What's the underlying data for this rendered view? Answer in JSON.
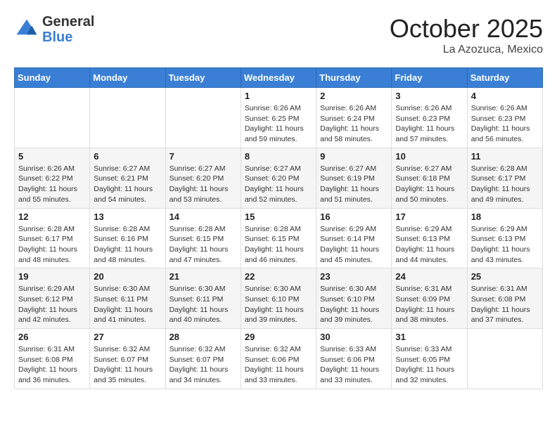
{
  "header": {
    "logo_general": "General",
    "logo_blue": "Blue",
    "month_title": "October 2025",
    "location": "La Azozuca, Mexico"
  },
  "calendar": {
    "days_of_week": [
      "Sunday",
      "Monday",
      "Tuesday",
      "Wednesday",
      "Thursday",
      "Friday",
      "Saturday"
    ],
    "weeks": [
      [
        {
          "day": "",
          "info": ""
        },
        {
          "day": "",
          "info": ""
        },
        {
          "day": "",
          "info": ""
        },
        {
          "day": "1",
          "info": "Sunrise: 6:26 AM\nSunset: 6:25 PM\nDaylight: 11 hours and 59 minutes."
        },
        {
          "day": "2",
          "info": "Sunrise: 6:26 AM\nSunset: 6:24 PM\nDaylight: 11 hours and 58 minutes."
        },
        {
          "day": "3",
          "info": "Sunrise: 6:26 AM\nSunset: 6:23 PM\nDaylight: 11 hours and 57 minutes."
        },
        {
          "day": "4",
          "info": "Sunrise: 6:26 AM\nSunset: 6:23 PM\nDaylight: 11 hours and 56 minutes."
        }
      ],
      [
        {
          "day": "5",
          "info": "Sunrise: 6:26 AM\nSunset: 6:22 PM\nDaylight: 11 hours and 55 minutes."
        },
        {
          "day": "6",
          "info": "Sunrise: 6:27 AM\nSunset: 6:21 PM\nDaylight: 11 hours and 54 minutes."
        },
        {
          "day": "7",
          "info": "Sunrise: 6:27 AM\nSunset: 6:20 PM\nDaylight: 11 hours and 53 minutes."
        },
        {
          "day": "8",
          "info": "Sunrise: 6:27 AM\nSunset: 6:20 PM\nDaylight: 11 hours and 52 minutes."
        },
        {
          "day": "9",
          "info": "Sunrise: 6:27 AM\nSunset: 6:19 PM\nDaylight: 11 hours and 51 minutes."
        },
        {
          "day": "10",
          "info": "Sunrise: 6:27 AM\nSunset: 6:18 PM\nDaylight: 11 hours and 50 minutes."
        },
        {
          "day": "11",
          "info": "Sunrise: 6:28 AM\nSunset: 6:17 PM\nDaylight: 11 hours and 49 minutes."
        }
      ],
      [
        {
          "day": "12",
          "info": "Sunrise: 6:28 AM\nSunset: 6:17 PM\nDaylight: 11 hours and 48 minutes."
        },
        {
          "day": "13",
          "info": "Sunrise: 6:28 AM\nSunset: 6:16 PM\nDaylight: 11 hours and 48 minutes."
        },
        {
          "day": "14",
          "info": "Sunrise: 6:28 AM\nSunset: 6:15 PM\nDaylight: 11 hours and 47 minutes."
        },
        {
          "day": "15",
          "info": "Sunrise: 6:28 AM\nSunset: 6:15 PM\nDaylight: 11 hours and 46 minutes."
        },
        {
          "day": "16",
          "info": "Sunrise: 6:29 AM\nSunset: 6:14 PM\nDaylight: 11 hours and 45 minutes."
        },
        {
          "day": "17",
          "info": "Sunrise: 6:29 AM\nSunset: 6:13 PM\nDaylight: 11 hours and 44 minutes."
        },
        {
          "day": "18",
          "info": "Sunrise: 6:29 AM\nSunset: 6:13 PM\nDaylight: 11 hours and 43 minutes."
        }
      ],
      [
        {
          "day": "19",
          "info": "Sunrise: 6:29 AM\nSunset: 6:12 PM\nDaylight: 11 hours and 42 minutes."
        },
        {
          "day": "20",
          "info": "Sunrise: 6:30 AM\nSunset: 6:11 PM\nDaylight: 11 hours and 41 minutes."
        },
        {
          "day": "21",
          "info": "Sunrise: 6:30 AM\nSunset: 6:11 PM\nDaylight: 11 hours and 40 minutes."
        },
        {
          "day": "22",
          "info": "Sunrise: 6:30 AM\nSunset: 6:10 PM\nDaylight: 11 hours and 39 minutes."
        },
        {
          "day": "23",
          "info": "Sunrise: 6:30 AM\nSunset: 6:10 PM\nDaylight: 11 hours and 39 minutes."
        },
        {
          "day": "24",
          "info": "Sunrise: 6:31 AM\nSunset: 6:09 PM\nDaylight: 11 hours and 38 minutes."
        },
        {
          "day": "25",
          "info": "Sunrise: 6:31 AM\nSunset: 6:08 PM\nDaylight: 11 hours and 37 minutes."
        }
      ],
      [
        {
          "day": "26",
          "info": "Sunrise: 6:31 AM\nSunset: 6:08 PM\nDaylight: 11 hours and 36 minutes."
        },
        {
          "day": "27",
          "info": "Sunrise: 6:32 AM\nSunset: 6:07 PM\nDaylight: 11 hours and 35 minutes."
        },
        {
          "day": "28",
          "info": "Sunrise: 6:32 AM\nSunset: 6:07 PM\nDaylight: 11 hours and 34 minutes."
        },
        {
          "day": "29",
          "info": "Sunrise: 6:32 AM\nSunset: 6:06 PM\nDaylight: 11 hours and 33 minutes."
        },
        {
          "day": "30",
          "info": "Sunrise: 6:33 AM\nSunset: 6:06 PM\nDaylight: 11 hours and 33 minutes."
        },
        {
          "day": "31",
          "info": "Sunrise: 6:33 AM\nSunset: 6:05 PM\nDaylight: 11 hours and 32 minutes."
        },
        {
          "day": "",
          "info": ""
        }
      ]
    ]
  }
}
